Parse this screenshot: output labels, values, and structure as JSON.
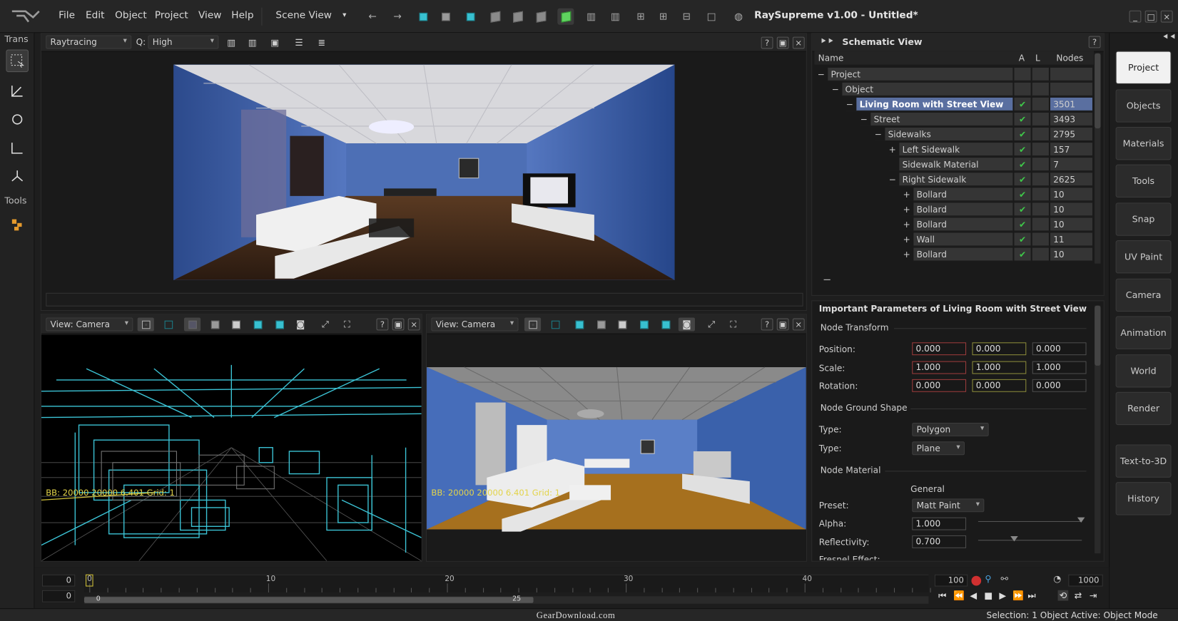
{
  "menubar": {
    "items": [
      "File",
      "Edit",
      "Object",
      "Project",
      "View",
      "Help"
    ],
    "scene_view": "Scene View",
    "app_title": "RaySupreme v1.00 - Untitled*"
  },
  "lefttools": {
    "trans_label": "Trans",
    "tools_label": "Tools"
  },
  "render_panel": {
    "mode": "Raytracing",
    "quality_label": "Q:",
    "quality": "High"
  },
  "viewport_left": {
    "view": "View: Camera",
    "overlay": "BB: 20000 20000 6.401   Grid: 1"
  },
  "viewport_right": {
    "view": "View: Camera",
    "overlay": "BB: 20000 20000 6.401   Grid: 1"
  },
  "schematic": {
    "title": "Schematic View",
    "columns": [
      "Name",
      "A",
      "L",
      "Nodes"
    ],
    "rows": [
      {
        "toggle": "−",
        "name": "Project",
        "a": "",
        "nodes": "",
        "depth": 0
      },
      {
        "toggle": "−",
        "name": "Object",
        "a": "",
        "nodes": "",
        "depth": 1
      },
      {
        "toggle": "−",
        "name": "Living Room with Street View",
        "a": "✔",
        "nodes": "3501",
        "depth": 2,
        "selected": true
      },
      {
        "toggle": "−",
        "name": "Street",
        "a": "✔",
        "nodes": "3493",
        "depth": 3
      },
      {
        "toggle": "−",
        "name": "Sidewalks",
        "a": "✔",
        "nodes": "2795",
        "depth": 4
      },
      {
        "toggle": "+",
        "name": "Left Sidewalk",
        "a": "✔",
        "nodes": "157",
        "depth": 5
      },
      {
        "toggle": "",
        "name": "Sidewalk Material",
        "a": "✔",
        "nodes": "7",
        "depth": 5
      },
      {
        "toggle": "−",
        "name": "Right Sidewalk",
        "a": "✔",
        "nodes": "2625",
        "depth": 5
      },
      {
        "toggle": "+",
        "name": "Bollard",
        "a": "✔",
        "nodes": "10",
        "depth": 6
      },
      {
        "toggle": "+",
        "name": "Bollard",
        "a": "✔",
        "nodes": "10",
        "depth": 6
      },
      {
        "toggle": "+",
        "name": "Bollard",
        "a": "✔",
        "nodes": "10",
        "depth": 6
      },
      {
        "toggle": "+",
        "name": "Wall",
        "a": "✔",
        "nodes": "11",
        "depth": 6
      },
      {
        "toggle": "+",
        "name": "Bollard",
        "a": "✔",
        "nodes": "10",
        "depth": 6
      }
    ],
    "collapse": "−"
  },
  "params": {
    "title": "Important Parameters of Living Room with Street View",
    "node_transform": "Node Transform",
    "position_label": "Position:",
    "position": [
      "0.000",
      "0.000",
      "0.000"
    ],
    "scale_label": "Scale:",
    "scale": [
      "1.000",
      "1.000",
      "1.000"
    ],
    "rotation_label": "Rotation:",
    "rotation": [
      "0.000",
      "0.000",
      "0.000"
    ],
    "ground_shape": "Node Ground Shape",
    "type_label": "Type:",
    "type1": "Polygon",
    "type2": "Plane",
    "node_material": "Node Material",
    "general": "General",
    "preset_label": "Preset:",
    "preset": "Matt Paint",
    "alpha_label": "Alpha:",
    "alpha": "1.000",
    "reflectivity_label": "Reflectivity:",
    "reflectivity": "0.700",
    "fresnel_label": "Fresnel Effect:"
  },
  "rightbar": {
    "buttons": [
      "Project",
      "Objects",
      "Materials",
      "Tools",
      "Snap",
      "UV Paint",
      "Camera",
      "Animation",
      "World",
      "Render",
      "Text-to-3D",
      "History"
    ]
  },
  "timeline": {
    "start1": "0",
    "start2": "0",
    "ticks": [
      "0",
      "10",
      "20",
      "30",
      "40"
    ],
    "scroll_marks": [
      "0",
      "25"
    ],
    "frames": "100",
    "end": "1000"
  },
  "statusbar": {
    "watermark": "GearDownload.com",
    "selection": "Selection: 1 Object  Active: Object Mode"
  }
}
